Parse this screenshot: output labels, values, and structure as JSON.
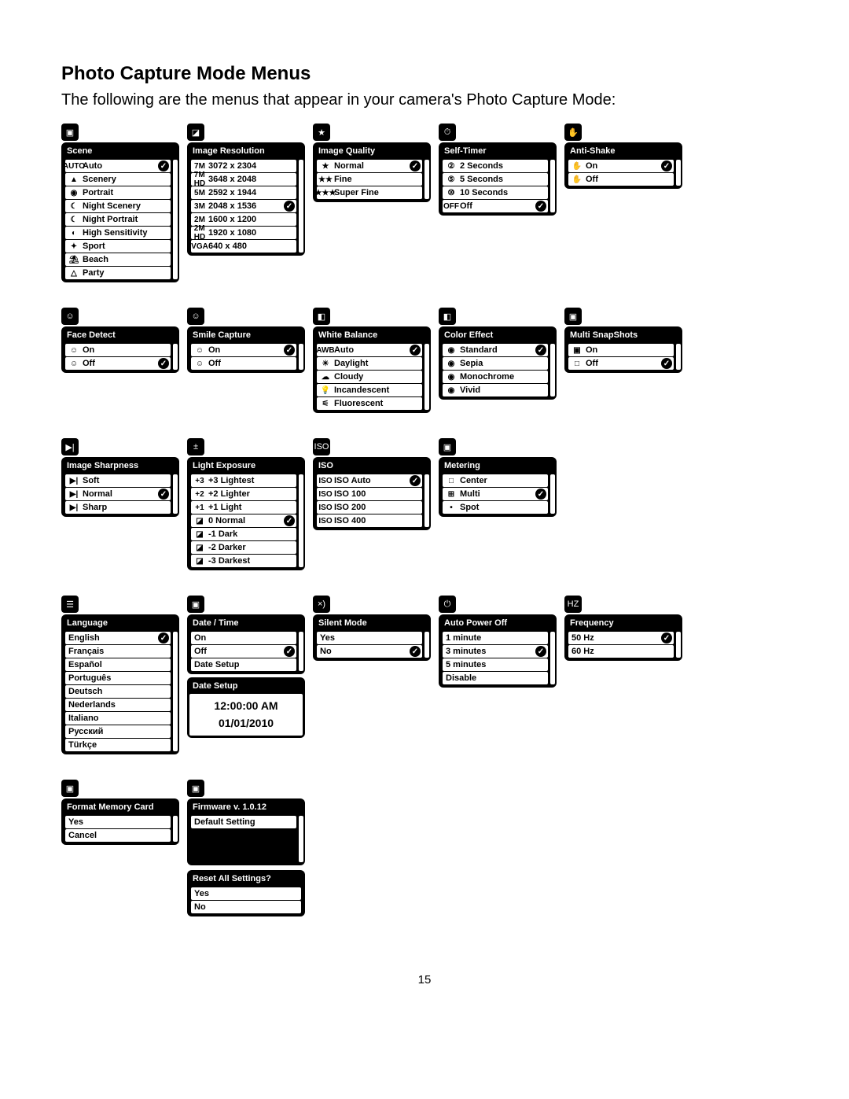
{
  "page_number": "15",
  "heading": "Photo Capture Mode Menus",
  "intro": "The following are the menus that appear in your camera's Photo Capture Mode:",
  "menus": [
    {
      "id": "scene",
      "icon": "▣",
      "title": "Scene",
      "items": [
        {
          "icon": "AUTO",
          "label": "Auto",
          "sel": true
        },
        {
          "icon": "▲",
          "label": "Scenery"
        },
        {
          "icon": "◉",
          "label": "Portrait"
        },
        {
          "icon": "☾",
          "label": "Night Scenery"
        },
        {
          "icon": "☾",
          "label": "Night Portrait"
        },
        {
          "icon": "◐",
          "label": "High Sensitivity"
        },
        {
          "icon": "✦",
          "label": "Sport"
        },
        {
          "icon": "⛱",
          "label": "Beach"
        },
        {
          "icon": "△",
          "label": "Party"
        }
      ]
    },
    {
      "id": "image-resolution",
      "icon": "◪",
      "title": "Image Resolution",
      "items": [
        {
          "icon": "7M",
          "label": "3072 x 2304"
        },
        {
          "icon": "7M HD",
          "label": "3648 x 2048"
        },
        {
          "icon": "5M",
          "label": "2592 x 1944"
        },
        {
          "icon": "3M",
          "label": "2048 x 1536",
          "sel": true
        },
        {
          "icon": "2M",
          "label": "1600 x 1200"
        },
        {
          "icon": "2M HD",
          "label": "1920 x 1080"
        },
        {
          "icon": "VGA",
          "label": "640 x 480"
        }
      ]
    },
    {
      "id": "image-quality",
      "icon": "★",
      "title": "Image Quality",
      "items": [
        {
          "icon": "★",
          "label": "Normal",
          "sel": true
        },
        {
          "icon": "★★",
          "label": "Fine"
        },
        {
          "icon": "★★★",
          "label": "Super Fine"
        }
      ]
    },
    {
      "id": "self-timer",
      "icon": "⏱",
      "title": "Self-Timer",
      "items": [
        {
          "icon": "②",
          "label": "2 Seconds"
        },
        {
          "icon": "⑤",
          "label": "5 Seconds"
        },
        {
          "icon": "⑩",
          "label": "10 Seconds"
        },
        {
          "icon": "OFF",
          "label": "Off",
          "sel": true
        }
      ]
    },
    {
      "id": "anti-shake",
      "icon": "✋",
      "title": "Anti-Shake",
      "items": [
        {
          "icon": "✋",
          "label": "On",
          "sel": true
        },
        {
          "icon": "✋",
          "label": "Off"
        }
      ]
    },
    {
      "id": "face-detect",
      "icon": "☺",
      "title": "Face Detect",
      "items": [
        {
          "icon": "☺",
          "label": "On"
        },
        {
          "icon": "☺",
          "label": "Off",
          "sel": true
        }
      ]
    },
    {
      "id": "smile-capture",
      "icon": "☺",
      "title": "Smile Capture",
      "items": [
        {
          "icon": "☺",
          "label": "On",
          "sel": true
        },
        {
          "icon": "☺",
          "label": "Off"
        }
      ]
    },
    {
      "id": "white-balance",
      "icon": "◧",
      "title": "White Balance",
      "items": [
        {
          "icon": "AWB",
          "label": "Auto",
          "sel": true
        },
        {
          "icon": "☀",
          "label": "Daylight"
        },
        {
          "icon": "☁",
          "label": "Cloudy"
        },
        {
          "icon": "💡",
          "label": "Incandescent"
        },
        {
          "icon": "⚟",
          "label": "Fluorescent"
        }
      ]
    },
    {
      "id": "color-effect",
      "icon": "◧",
      "title": "Color Effect",
      "items": [
        {
          "icon": "◉",
          "label": "Standard",
          "sel": true
        },
        {
          "icon": "◉",
          "label": "Sepia"
        },
        {
          "icon": "◉",
          "label": "Monochrome"
        },
        {
          "icon": "◉",
          "label": "Vivid"
        }
      ]
    },
    {
      "id": "multi-snapshots",
      "icon": "▣",
      "title": "Multi SnapShots",
      "items": [
        {
          "icon": "▣",
          "label": "On"
        },
        {
          "icon": "□",
          "label": "Off",
          "sel": true
        }
      ]
    },
    {
      "id": "image-sharpness",
      "icon": "▶|",
      "title": "Image Sharpness",
      "items": [
        {
          "icon": "▶|",
          "label": "Soft"
        },
        {
          "icon": "▶|",
          "label": "Normal",
          "sel": true
        },
        {
          "icon": "▶|",
          "label": "Sharp"
        }
      ]
    },
    {
      "id": "light-exposure",
      "icon": "±",
      "title": "Light Exposure",
      "items": [
        {
          "icon": "+3",
          "label": "+3 Lightest"
        },
        {
          "icon": "+2",
          "label": "+2 Lighter"
        },
        {
          "icon": "+1",
          "label": "+1 Light"
        },
        {
          "icon": "◪",
          "label": "0 Normal",
          "sel": true
        },
        {
          "icon": "◪",
          "label": "-1 Dark"
        },
        {
          "icon": "◪",
          "label": "-2 Darker"
        },
        {
          "icon": "◪",
          "label": "-3 Darkest"
        }
      ]
    },
    {
      "id": "iso",
      "icon": "ISO",
      "title": "ISO",
      "items": [
        {
          "icon": "ISO",
          "label": "ISO Auto",
          "sel": true
        },
        {
          "icon": "ISO",
          "label": "ISO 100"
        },
        {
          "icon": "ISO",
          "label": "ISO 200"
        },
        {
          "icon": "ISO",
          "label": "ISO 400"
        }
      ]
    },
    {
      "id": "metering",
      "icon": "▣",
      "title": "Metering",
      "items": [
        {
          "icon": "□",
          "label": "Center"
        },
        {
          "icon": "⊞",
          "label": "Multi",
          "sel": true
        },
        {
          "icon": "•",
          "label": "Spot"
        }
      ]
    },
    {
      "id": "language",
      "icon": "☰",
      "title": "Language",
      "items": [
        {
          "label": "English",
          "sel": true
        },
        {
          "label": "Français"
        },
        {
          "label": "Español"
        },
        {
          "label": "Português"
        },
        {
          "label": "Deutsch"
        },
        {
          "label": "Nederlands"
        },
        {
          "label": "Italiano"
        },
        {
          "label": "Русский"
        },
        {
          "label": "Türkçe"
        }
      ]
    },
    {
      "id": "date-time",
      "icon": "▣",
      "title": "Date / Time",
      "items": [
        {
          "label": "On"
        },
        {
          "label": "Off",
          "sel": true
        },
        {
          "label": "Date Setup"
        }
      ],
      "dateSetup": {
        "title": "Date Setup",
        "time": "12:00:00 AM",
        "date": "01/01/2010"
      }
    },
    {
      "id": "silent-mode",
      "icon": "×)",
      "title": "Silent Mode",
      "items": [
        {
          "label": "Yes"
        },
        {
          "label": "No",
          "sel": true
        }
      ]
    },
    {
      "id": "auto-power-off",
      "icon": "⏻",
      "title": "Auto Power Off",
      "items": [
        {
          "label": "1 minute"
        },
        {
          "label": "3 minutes",
          "sel": true
        },
        {
          "label": "5 minutes"
        },
        {
          "label": "Disable"
        }
      ]
    },
    {
      "id": "frequency",
      "icon": "HZ",
      "title": "Frequency",
      "items": [
        {
          "label": "50 Hz",
          "sel": true
        },
        {
          "label": "60 Hz"
        }
      ]
    },
    {
      "id": "format-memory",
      "icon": "▣",
      "title": "Format Memory Card",
      "items": [
        {
          "label": "Yes"
        },
        {
          "label": "Cancel"
        }
      ]
    },
    {
      "id": "firmware",
      "icon": "▣",
      "title": "Firmware v. 1.0.12",
      "items": [
        {
          "label": "Default Setting"
        }
      ],
      "black_body": true,
      "reset": {
        "title": "Reset All Settings?",
        "items": [
          {
            "label": "Yes"
          },
          {
            "label": "No"
          }
        ]
      }
    }
  ],
  "row_breaks": [
    5,
    10,
    14,
    19,
    21
  ]
}
